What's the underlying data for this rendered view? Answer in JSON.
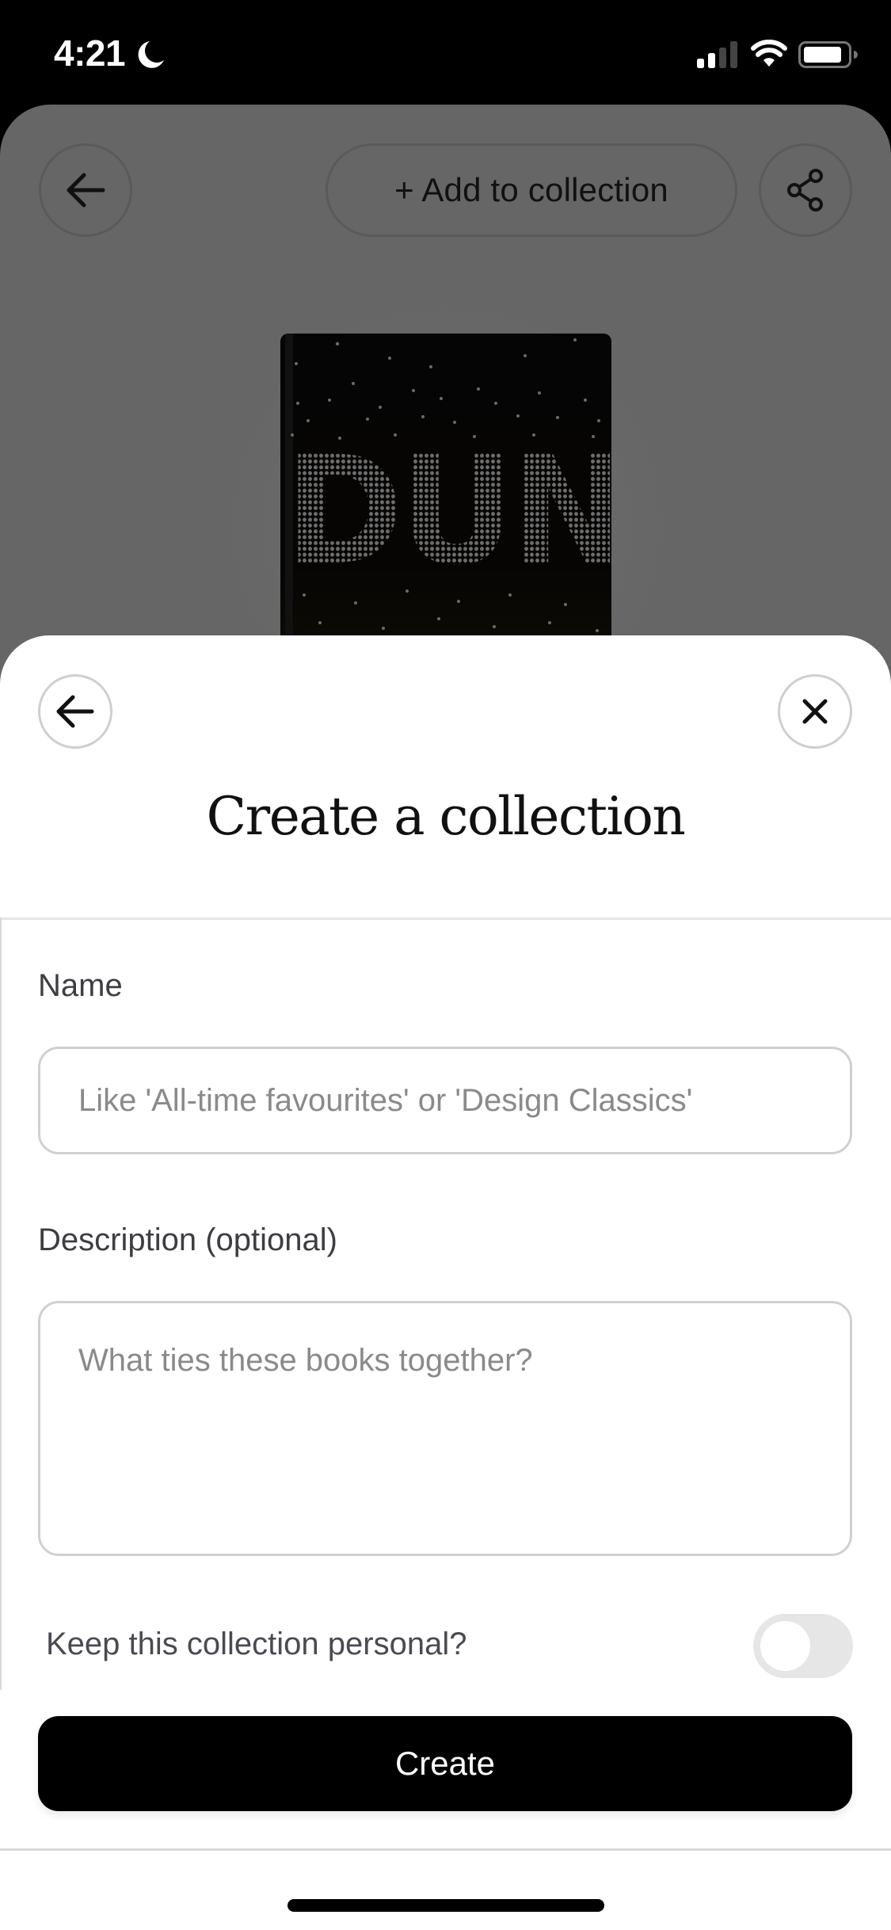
{
  "status_bar": {
    "time": "4:21",
    "icons": [
      "moon-icon",
      "cellular-signal-icon",
      "wifi-icon",
      "battery-icon"
    ]
  },
  "background_screen": {
    "back_button_icon": "arrow-left-icon",
    "add_to_collection_label": "+ Add to collection",
    "share_button_icon": "share-icon",
    "book_cover_title": "DUNE"
  },
  "sheet": {
    "back_button_icon": "arrow-left-icon",
    "close_button_icon": "close-icon",
    "title": "Create a collection",
    "name_field": {
      "label": "Name",
      "value": "",
      "placeholder": "Like 'All-time favourites' or 'Design Classics'"
    },
    "description_field": {
      "label": "Description (optional)",
      "value": "",
      "placeholder": "What ties these books together?"
    },
    "personal_toggle": {
      "label": "Keep this collection personal?",
      "checked": false
    },
    "create_button_label": "Create"
  }
}
